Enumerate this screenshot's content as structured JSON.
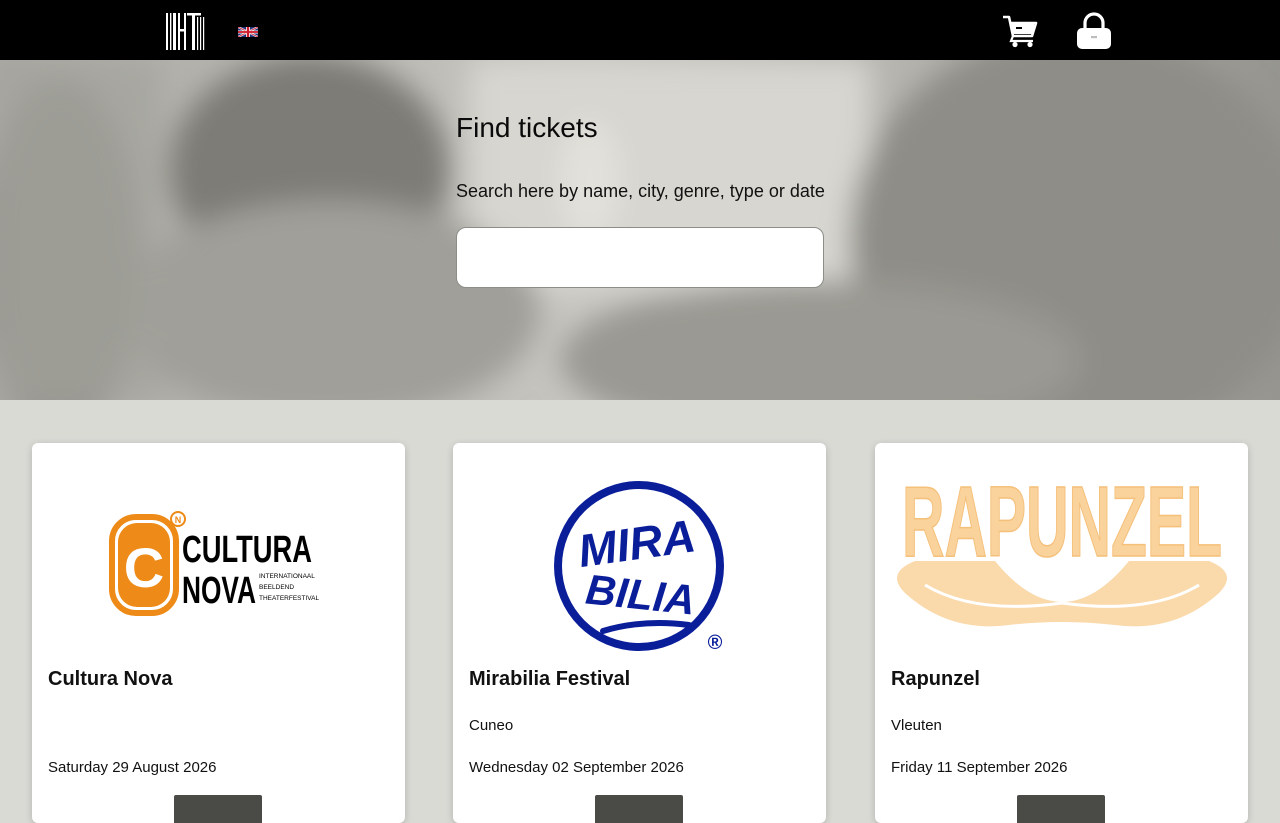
{
  "header": {
    "logo_icon": "iht-barcode-logo",
    "language_icon": "uk-flag-icon",
    "cart_icon": "shopping-cart-icon",
    "account_icon": "lock-icon"
  },
  "hero": {
    "title": "Find tickets",
    "subtitle": "Search here by name, city, genre, type or date",
    "search_value": ""
  },
  "events": [
    {
      "title": "Cultura Nova",
      "city": "",
      "date": "Saturday 29 August 2026",
      "logo": {
        "brand": "CULTURA",
        "brand2": "NOVA",
        "letter": "C",
        "tagline1": "INTERNATIONAAL",
        "tagline2": "BEELDEND",
        "tagline3": "THEATERFESTIVAL",
        "accent": "#ee8a17"
      }
    },
    {
      "title": "Mirabilia Festival",
      "city": "Cuneo",
      "date": "Wednesday 02 September 2026",
      "logo": {
        "line1": "MIRA",
        "line2": "BILIA",
        "mark": "®",
        "accent": "#0a1e9a"
      }
    },
    {
      "title": "Rapunzel",
      "city": "Vleuten",
      "date": "Friday 11 September 2026",
      "logo": {
        "word": "RAPUNZEL",
        "accent": "#f9d29c"
      }
    }
  ]
}
